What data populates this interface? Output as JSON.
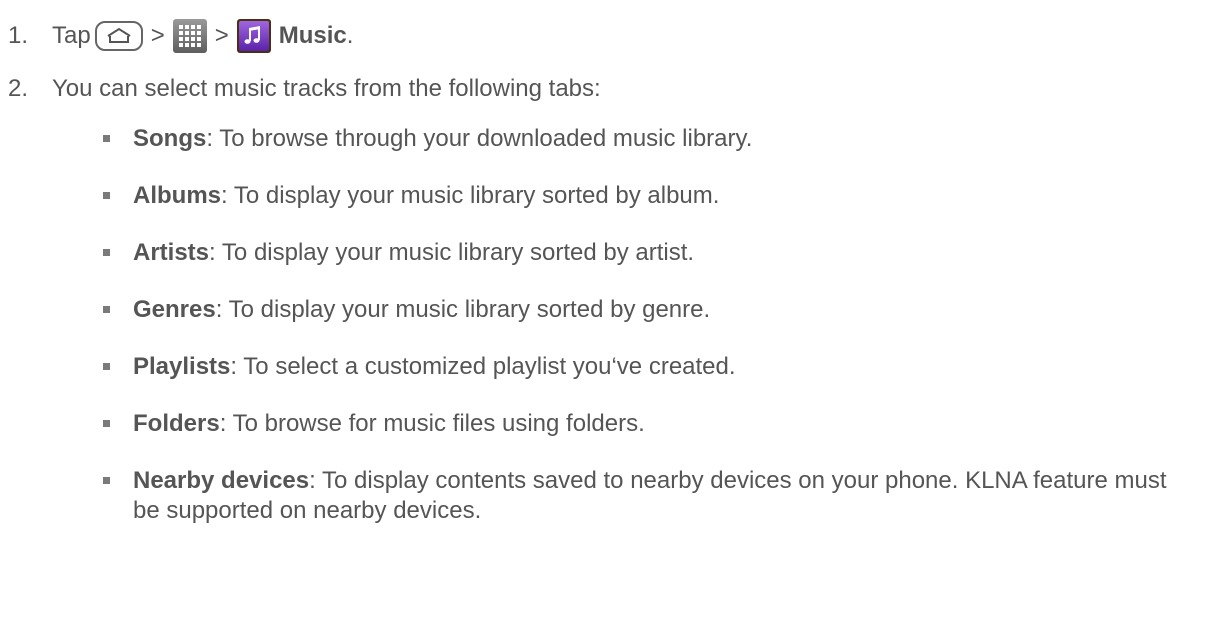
{
  "steps": [
    {
      "number": "1.",
      "prefix": "Tap",
      "separator1": ">",
      "separator2": ">",
      "app_name": "Music",
      "suffix": "."
    },
    {
      "number": "2.",
      "text": "You can select music tracks from the following tabs:"
    }
  ],
  "tabs": [
    {
      "name": "Songs",
      "description": ": To browse through your downloaded music library."
    },
    {
      "name": "Albums",
      "description": ": To display your music library sorted by album."
    },
    {
      "name": "Artists",
      "description": ": To display your music library sorted by artist."
    },
    {
      "name": "Genres",
      "description": ": To display your music library sorted by genre."
    },
    {
      "name": "Playlists",
      "description": ": To select a customized playlist you‘ve created."
    },
    {
      "name": "Folders",
      "description": ": To browse for music files using folders."
    },
    {
      "name": "Nearby devices",
      "description": ": To display contents saved to nearby devices on your phone. KLNA feature must be supported on nearby devices."
    }
  ],
  "icons": {
    "home": "home-key-icon",
    "apps": "apps-grid-icon",
    "music": "music-app-icon"
  },
  "colors": {
    "text": "#555555",
    "bullet": "#7a7a7a",
    "music_icon_bg": "#7b3fc4"
  }
}
